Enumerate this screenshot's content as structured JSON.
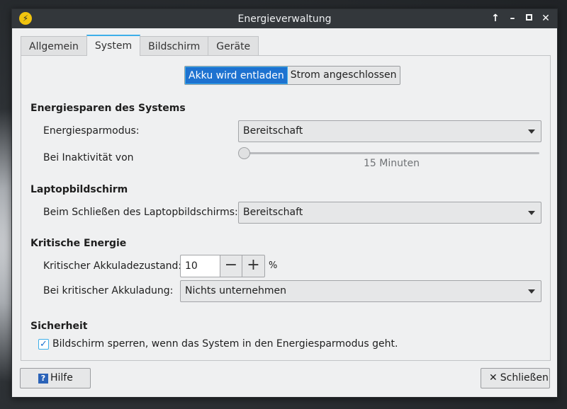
{
  "window": {
    "title": "Energieverwaltung",
    "app_icon": "lightning-icon",
    "controls": {
      "up": "↑",
      "minimize": "–",
      "close": "✕"
    }
  },
  "tabs": [
    {
      "label": "Allgemein",
      "active": false
    },
    {
      "label": "System",
      "active": true
    },
    {
      "label": "Bildschirm",
      "active": false
    },
    {
      "label": "Geräte",
      "active": false
    }
  ],
  "mode_toggle": {
    "battery": "Akku wird entladen",
    "plugged": "Strom angeschlossen",
    "selected": "battery"
  },
  "sections": {
    "system_power": {
      "heading": "Energiesparen des Systems",
      "mode_label": "Energiesparmodus:",
      "mode_value": "Bereitschaft",
      "inactivity_label": "Bei Inaktivität von",
      "inactivity_value": "15 Minuten",
      "inactivity_minutes": 15
    },
    "laptop_display": {
      "heading": "Laptopbildschirm",
      "lid_label": "Beim Schließen des Laptopbildschirms:",
      "lid_value": "Bereitschaft"
    },
    "critical": {
      "heading": "Kritische Energie",
      "level_label": "Kritischer Akkuladezustand:",
      "level_value": "10",
      "level_unit": "%",
      "minus": "−",
      "plus": "+",
      "action_label": "Bei kritischer Akkuladung:",
      "action_value": "Nichts unternehmen"
    },
    "security": {
      "heading": "Sicherheit",
      "lock_label": "Bildschirm sperren, wenn das System in den Energiesparmodus geht.",
      "lock_checked": true,
      "check_mark": "✓"
    }
  },
  "footer": {
    "help_label": "Hilfe",
    "help_icon_glyph": "?",
    "close_label": "Schließen",
    "close_icon_glyph": "✕"
  },
  "colors": {
    "accent": "#3daee9",
    "selected": "#1d72d0",
    "titlebar": "#33373b"
  }
}
